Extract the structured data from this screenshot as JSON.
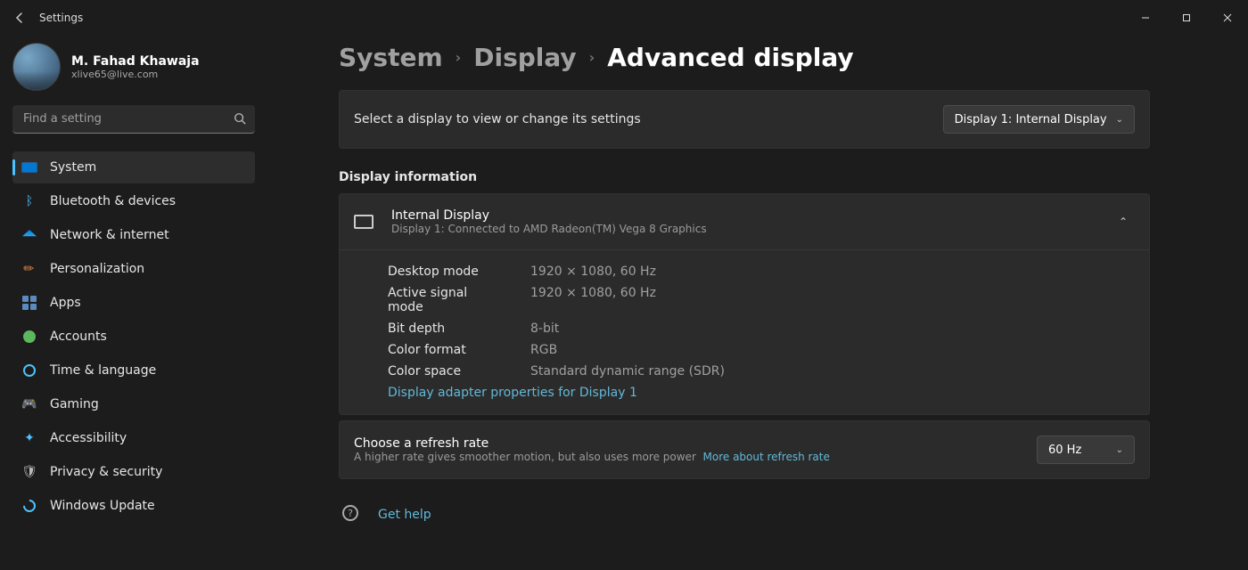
{
  "window": {
    "title": "Settings"
  },
  "profile": {
    "name": "M. Fahad Khawaja",
    "email": "xlive65@live.com"
  },
  "search": {
    "placeholder": "Find a setting"
  },
  "nav": {
    "system": "System",
    "bluetooth": "Bluetooth & devices",
    "network": "Network & internet",
    "personalization": "Personalization",
    "apps": "Apps",
    "accounts": "Accounts",
    "time": "Time & language",
    "gaming": "Gaming",
    "accessibility": "Accessibility",
    "privacy": "Privacy & security",
    "update": "Windows Update"
  },
  "breadcrumb": {
    "system": "System",
    "display": "Display",
    "advanced": "Advanced display"
  },
  "selector": {
    "text": "Select a display to view or change its settings",
    "value": "Display 1: Internal Display"
  },
  "section": {
    "display_info": "Display information"
  },
  "info": {
    "title": "Internal Display",
    "sub": "Display 1: Connected to AMD Radeon(TM) Vega 8 Graphics",
    "rows": {
      "desktop_mode_label": "Desktop mode",
      "desktop_mode_value": "1920 × 1080, 60 Hz",
      "active_signal_label": "Active signal mode",
      "active_signal_value": "1920 × 1080, 60 Hz",
      "bit_depth_label": "Bit depth",
      "bit_depth_value": "8-bit",
      "color_format_label": "Color format",
      "color_format_value": "RGB",
      "color_space_label": "Color space",
      "color_space_value": "Standard dynamic range (SDR)"
    },
    "adapter_link": "Display adapter properties for Display 1"
  },
  "refresh_rate": {
    "title": "Choose a refresh rate",
    "sub": "A higher rate gives smoother motion, but also uses more power",
    "more_link": "More about refresh rate",
    "value": "60 Hz"
  },
  "help": {
    "label": "Get help"
  }
}
